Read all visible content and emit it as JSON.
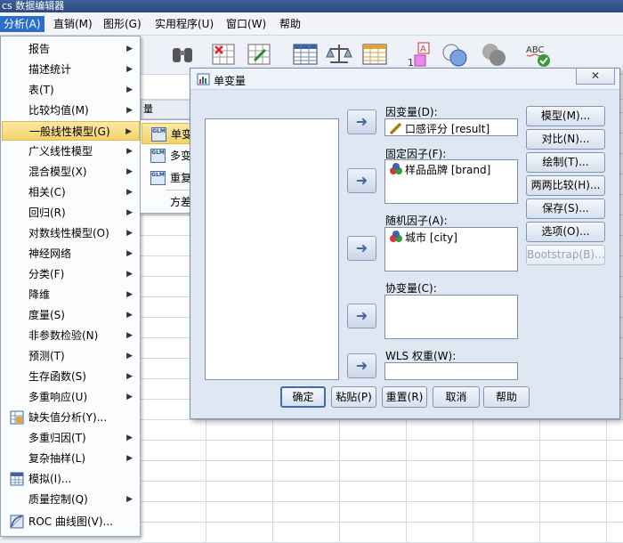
{
  "window_title": "cs 数据编辑器",
  "menubar": [
    {
      "label": "分析(A)",
      "active": true
    },
    {
      "label": "直销(M)"
    },
    {
      "label": "图形(G)"
    },
    {
      "label": "实用程序(U)"
    },
    {
      "label": "窗口(W)"
    },
    {
      "label": "帮助"
    }
  ],
  "grid_header": "量",
  "analyze_menu": [
    {
      "label": "报告",
      "submenu": true
    },
    {
      "label": "描述统计",
      "submenu": true
    },
    {
      "label": "表(T)",
      "submenu": true
    },
    {
      "label": "比较均值(M)",
      "submenu": true
    },
    {
      "label": "一般线性模型(G)",
      "submenu": true,
      "highlighted": true
    },
    {
      "label": "广义线性模型",
      "submenu": true
    },
    {
      "label": "混合模型(X)",
      "submenu": true
    },
    {
      "label": "相关(C)",
      "submenu": true
    },
    {
      "label": "回归(R)",
      "submenu": true
    },
    {
      "label": "对数线性模型(O)",
      "submenu": true
    },
    {
      "label": "神经网络",
      "submenu": true
    },
    {
      "label": "分类(F)",
      "submenu": true
    },
    {
      "label": "降维",
      "submenu": true
    },
    {
      "label": "度量(S)",
      "submenu": true
    },
    {
      "label": "非参数检验(N)",
      "submenu": true
    },
    {
      "label": "预测(T)",
      "submenu": true
    },
    {
      "label": "生存函数(S)",
      "submenu": true
    },
    {
      "label": "多重响应(U)",
      "submenu": true
    },
    {
      "label": "缺失值分析(Y)...",
      "icon": "missing-value-icon"
    },
    {
      "label": "多重归因(T)",
      "submenu": true
    },
    {
      "label": "复杂抽样(L)",
      "submenu": true
    },
    {
      "label": "模拟(I)...",
      "icon": "simulation-icon"
    },
    {
      "label": "质量控制(Q)",
      "submenu": true
    },
    {
      "label": "ROC 曲线图(V)...",
      "icon": "roc-curve-icon"
    }
  ],
  "glm_submenu": [
    {
      "label": "单变量(U)...",
      "highlighted": true,
      "icon": "univariate-icon"
    },
    {
      "label": "多变量(M)...",
      "icon": "multivariate-icon"
    },
    {
      "label": "重复度量(R)...",
      "icon": "repeated-measures-icon"
    },
    {
      "label": "方差分量估计(V)..."
    }
  ],
  "dialog": {
    "title": "单变量",
    "close": "✕",
    "dependent_label": "因变量(D):",
    "dependent_value": "口感评分 [result]",
    "fixed_label": "固定因子(F):",
    "fixed_value": "样品品牌 [brand]",
    "random_label": "随机因子(A):",
    "random_value": "城市 [city]",
    "covariate_label": "协变量(C):",
    "wls_label": "WLS 权重(W):",
    "side_buttons": [
      "模型(M)...",
      "对比(N)...",
      "绘制(T)...",
      "两两比较(H)...",
      "保存(S)...",
      "选项(O)...",
      "Bootstrap(B)..."
    ],
    "bottom_buttons": [
      "确定",
      "粘贴(P)",
      "重置(R)",
      "取消",
      "帮助"
    ]
  },
  "colors": {
    "menu_highlight": "#f4d36b",
    "menubar_active": "#2b6ec6",
    "dialog_bg": "#dfe7f3"
  }
}
